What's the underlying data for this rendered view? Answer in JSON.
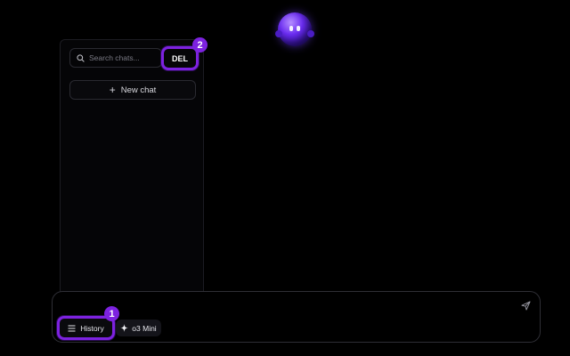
{
  "sidebar": {
    "search_placeholder": "Search chats...",
    "delete_label": "DEL",
    "new_chat_label": "New chat"
  },
  "composer": {
    "history_label": "History",
    "model_label": "o3 Mini",
    "send_icon": "send-icon"
  },
  "annotations": {
    "badge_1": "1",
    "badge_2": "2"
  },
  "colors": {
    "accent": "#7d22e0",
    "background": "#000000"
  }
}
